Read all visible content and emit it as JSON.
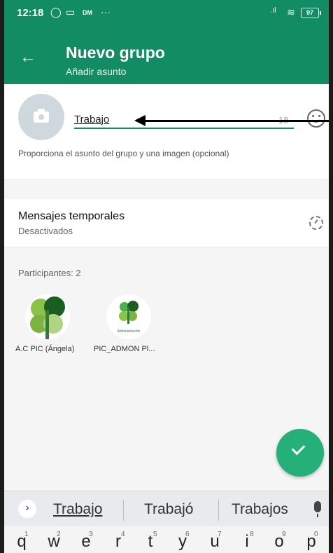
{
  "status_bar": {
    "time": "12:18",
    "carrier_tag": "DM",
    "battery": "97"
  },
  "header": {
    "title": "Nuevo grupo",
    "subtitle": "Añadir asunto"
  },
  "subject": {
    "value": "Trabajo",
    "counter": "18",
    "hint": "Proporciona el asunto del grupo y una imagen (opcional)"
  },
  "temp_messages": {
    "title": "Mensajes temporales",
    "status": "Desactivados"
  },
  "participants": {
    "label": "Participantes: 2",
    "items": [
      {
        "name": "A.C PIC (Ángela)"
      },
      {
        "name": "PIC_ADMON Pl...",
        "tag": "Administración"
      }
    ]
  },
  "keyboard": {
    "suggestions": [
      "Trabajo",
      "Trabajó",
      "Trabajos"
    ],
    "row1": [
      {
        "k": "q",
        "n": "1"
      },
      {
        "k": "w",
        "n": "2"
      },
      {
        "k": "e",
        "n": "3"
      },
      {
        "k": "r",
        "n": "4"
      },
      {
        "k": "t",
        "n": "5"
      },
      {
        "k": "y",
        "n": "6"
      },
      {
        "k": "u",
        "n": "7"
      },
      {
        "k": "i",
        "n": "8"
      },
      {
        "k": "o",
        "n": "9"
      },
      {
        "k": "p",
        "n": "0"
      }
    ]
  },
  "colors": {
    "primary": "#128c63",
    "fab": "#25b07a",
    "background": "#f5f5f5"
  },
  "icons": [
    "back-arrow-icon",
    "camera-icon",
    "emoji-icon",
    "timer-icon",
    "check-icon",
    "mic-icon",
    "chevron-right-icon",
    "whatsapp-icon",
    "wifi-icon",
    "signal-icon"
  ]
}
